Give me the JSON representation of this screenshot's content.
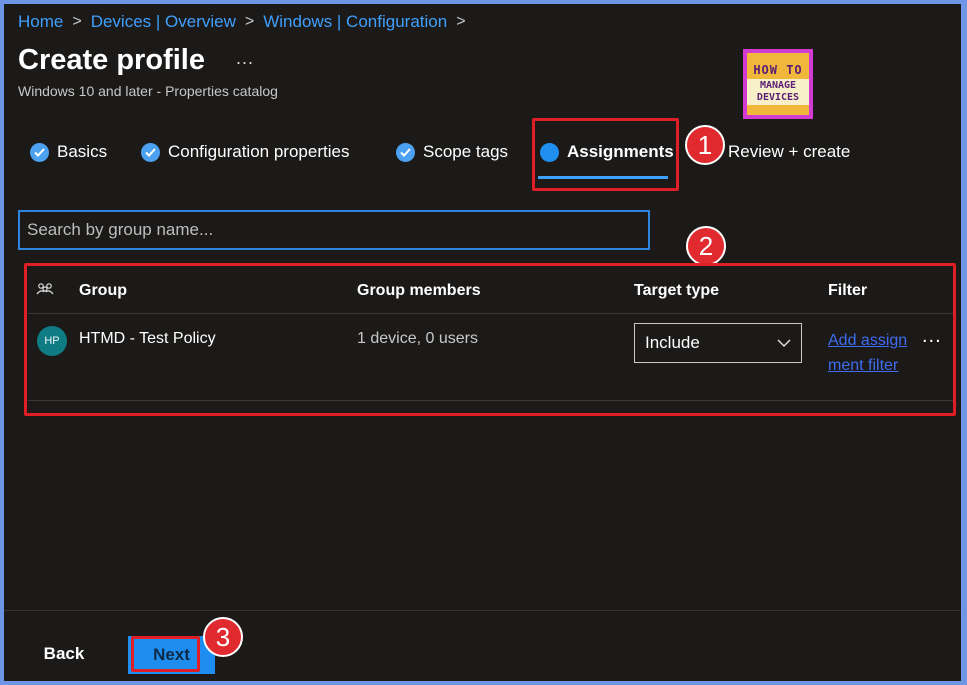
{
  "breadcrumb": [
    "Home",
    "Devices | Overview",
    "Windows | Configuration"
  ],
  "header": {
    "title": "Create profile",
    "more": "...",
    "subtitle": "Windows 10 and later - Properties catalog"
  },
  "logo": {
    "line1": "HOW TO",
    "line2": "MANAGE DEVICES"
  },
  "steps": [
    {
      "label": "Basics",
      "state": "done"
    },
    {
      "label": "Configuration properties",
      "state": "done"
    },
    {
      "label": "Scope tags",
      "state": "done"
    },
    {
      "label": "Assignments",
      "state": "current"
    },
    {
      "label": "Review + create",
      "state": "pending"
    }
  ],
  "annotations": {
    "one": "1",
    "two": "2",
    "three": "3"
  },
  "search": {
    "placeholder": "Search by group name..."
  },
  "table": {
    "headers": {
      "group": "Group",
      "members": "Group members",
      "target": "Target type",
      "filter": "Filter"
    },
    "rows": [
      {
        "avatar": "HP",
        "group": "HTMD - Test Policy",
        "members": "1 device, 0 users",
        "target": "Include",
        "filter": "Add assignment filter",
        "more": "..."
      }
    ]
  },
  "footer": {
    "back": "Back",
    "next": "Next"
  },
  "colors": {
    "accent": "#1d8ef0",
    "highlight": "#e01e25",
    "link": "#3f9ffc"
  }
}
